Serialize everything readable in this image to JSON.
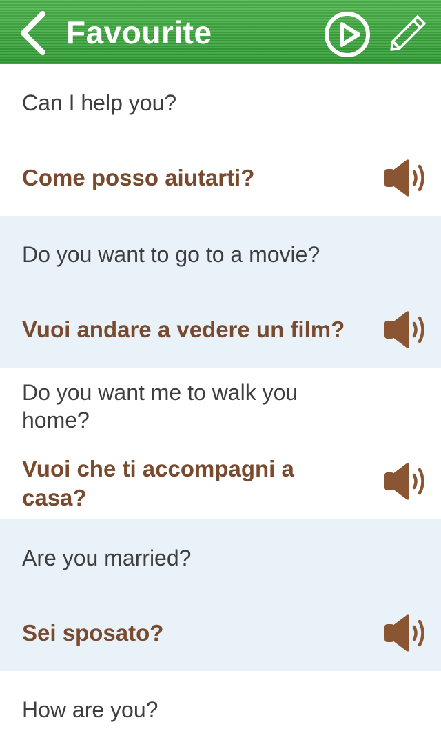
{
  "header": {
    "title": "Favourite",
    "colors": {
      "bar": "#37a23a",
      "icon": "#ffffff"
    }
  },
  "phrases": [
    {
      "en": "Can I help you?",
      "it": "Come posso aiutarti?"
    },
    {
      "en": "Do you want to go to a movie?",
      "it": "Vuoi andare a vedere un film?"
    },
    {
      "en": "Do you want me to walk you home?",
      "it": "Vuoi che ti accompagni a casa?"
    },
    {
      "en": "Are you married?",
      "it": "Sei sposato?"
    },
    {
      "en": "How are you?"
    }
  ],
  "icons": {
    "back": "chevron-left-icon",
    "play": "play-circle-icon",
    "edit": "pencil-icon",
    "speaker": "speaker-icon"
  },
  "colors": {
    "translation_text": "#7a4a2e",
    "source_text": "#3e3e3e",
    "row_alt_bg": "#e9f1f9",
    "speaker": "#8a5532"
  }
}
